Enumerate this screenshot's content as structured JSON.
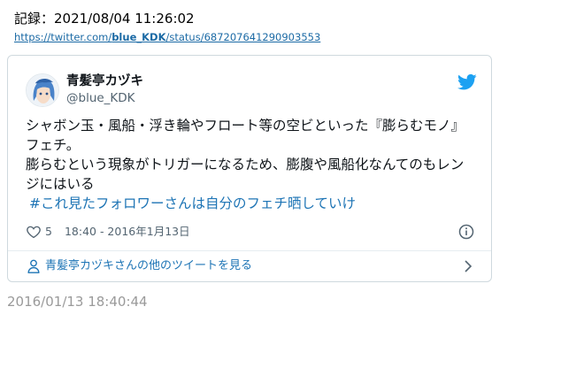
{
  "record": {
    "text": "記録：2021/08/04 11:26:02"
  },
  "link": {
    "prefix": "https://twitter.com/",
    "bold": "blue_KDK",
    "suffix": "/status/687207641290903553"
  },
  "tweet": {
    "display_name": "青髪亭カヅキ",
    "handle": "@blue_KDK",
    "lines": [
      "シャボン玉・風船・浮き輪やフロート等の空ビといった『膨らむモノ』フェチ。",
      "膨らむという現象がトリガーになるため、膨腹や風船化なんてのもレンジにはいる"
    ],
    "hashtag": "#これ見たフォロワーさんは自分のフェチ晒していけ",
    "likes": "5",
    "time": "18:40 - 2016年1月13日",
    "more_link": "青髪亭カヅキさんの他のツイートを見る"
  },
  "capture_timestamp": "2016/01/13 18:40:44",
  "colors": {
    "twitter_blue": "#1da1f2",
    "link_blue": "#1d74b5",
    "muted": "#536471"
  }
}
